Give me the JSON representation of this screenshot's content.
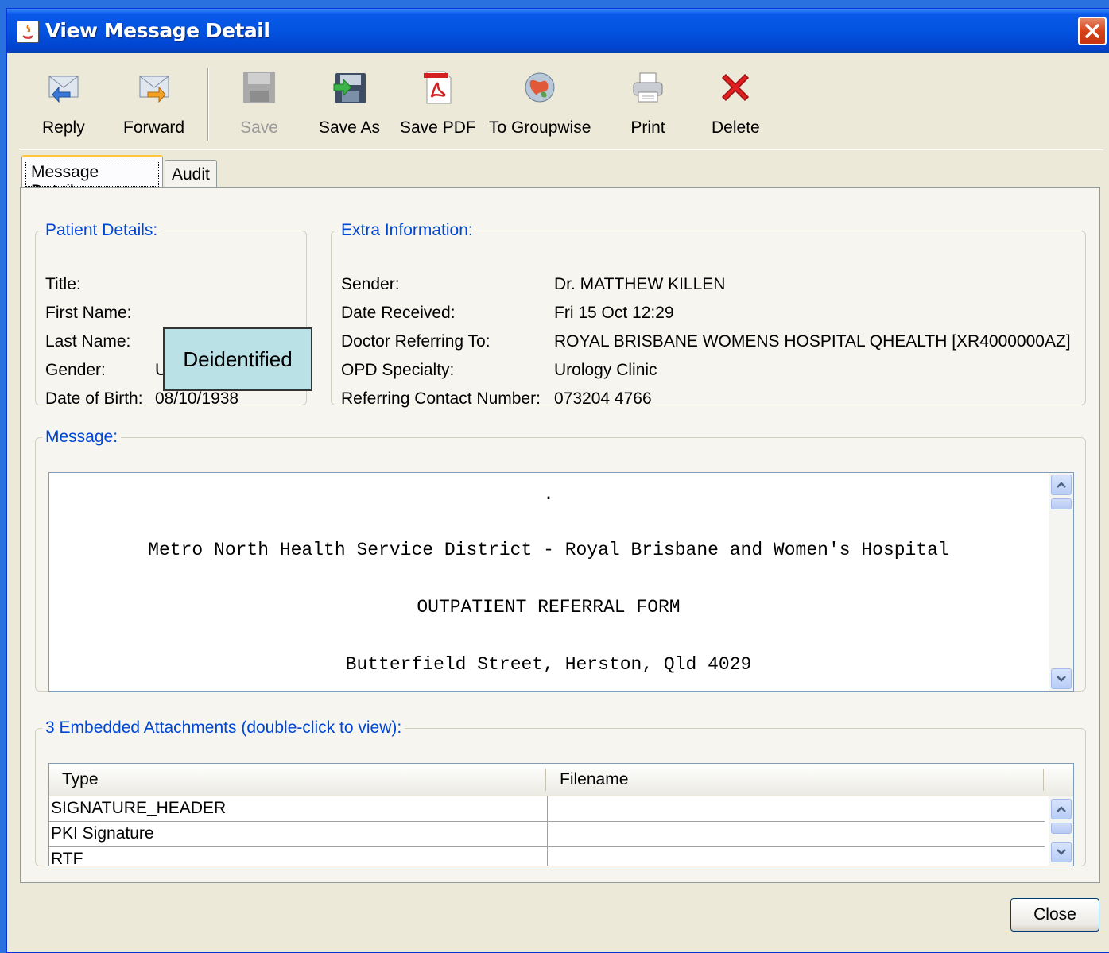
{
  "window": {
    "title": "View Message Detail"
  },
  "toolbar": {
    "reply": "Reply",
    "forward": "Forward",
    "save": "Save",
    "save_as": "Save As",
    "save_pdf": "Save PDF",
    "to_groupwise": "To Groupwise",
    "print": "Print",
    "delete": "Delete"
  },
  "tabs": {
    "message_details": "Message Details",
    "audit": "Audit"
  },
  "patient": {
    "legend": "Patient Details:",
    "title_label": "Title:",
    "first_name_label": "First Name:",
    "last_name_label": "Last Name:",
    "gender_label": "Gender:",
    "gender_value": "U",
    "dob_label": "Date of Birth:",
    "dob_value": "08/10/1938",
    "redaction_text": "Deidentified"
  },
  "extra": {
    "legend": "Extra Information:",
    "sender_label": "Sender:",
    "sender_value": "Dr. MATTHEW KILLEN",
    "date_received_label": "Date Received:",
    "date_received_value": "Fri 15 Oct 12:29",
    "doctor_referring_label": "Doctor Referring To:",
    "doctor_referring_value": "ROYAL BRISBANE WOMENS HOSPITAL QHEALTH [XR4000000AZ]",
    "opd_label": "OPD Specialty:",
    "opd_value": "Urology Clinic",
    "contact_label": "Referring Contact Number:",
    "contact_value": "073204 4766"
  },
  "message": {
    "legend": "Message:",
    "lines": [
      ".",
      "Metro North Health Service District - Royal Brisbane and Women's Hospital",
      "OUTPATIENT REFERRAL FORM",
      "Butterfield Street, Herston, Qld 4029"
    ]
  },
  "attachments": {
    "legend": "3 Embedded Attachments (double-click to view):",
    "columns": [
      "Type",
      "Filename"
    ],
    "rows": [
      {
        "type": "SIGNATURE_HEADER",
        "filename": ""
      },
      {
        "type": "PKI Signature",
        "filename": ""
      },
      {
        "type": "RTF",
        "filename": ""
      }
    ]
  },
  "footer": {
    "close": "Close"
  },
  "icons": {
    "java": "java-app-icon",
    "reply": "reply-icon",
    "forward": "forward-icon",
    "save": "floppy-disk-icon",
    "save_as": "save-as-icon",
    "save_pdf": "pdf-icon",
    "groupwise": "groupwise-icon",
    "print": "printer-icon",
    "delete": "red-x-icon"
  },
  "colors": {
    "titlebar": "#0354e0",
    "legend": "#0046d5",
    "redaction_bg": "#b9e1e6",
    "tab_highlight": "#ffc83c"
  }
}
